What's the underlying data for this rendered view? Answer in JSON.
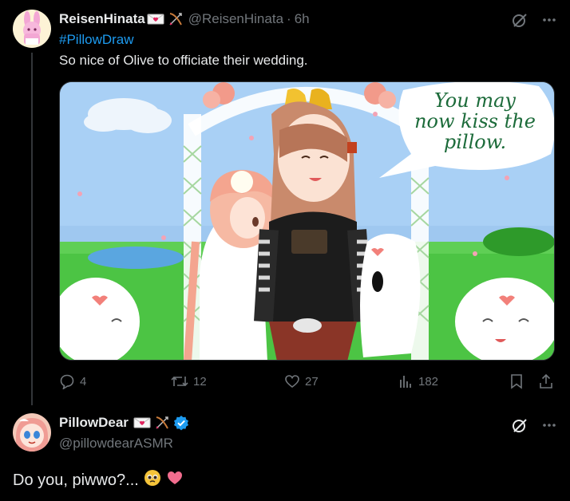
{
  "post": {
    "author_name": "ReisenHinata",
    "author_handle": "@ReisenHinata",
    "separator": "·",
    "time": "6h",
    "hashtag": "#PillowDraw",
    "text": "So nice of Olive to officiate their wedding.",
    "image_speech_text": [
      "You may",
      "now kiss the",
      "pillow."
    ],
    "stats": {
      "replies": "4",
      "reposts": "12",
      "likes": "27",
      "views": "182"
    }
  },
  "reply": {
    "author_name": "PillowDear",
    "author_handle": "@pillowdearASMR",
    "text": "Do you, piwwo?..."
  },
  "colors": {
    "link": "#1d9bf0",
    "muted": "#71767b",
    "text": "#e7e9ea",
    "verified": "#1d9bf0"
  },
  "icons": [
    "grok-icon",
    "more-icon",
    "reply-icon",
    "repost-icon",
    "like-icon",
    "views-icon",
    "bookmark-icon",
    "share-icon",
    "verified-icon",
    "love-letter-icon",
    "bow-arrow-icon",
    "pleading-face-emoji",
    "heart-emoji"
  ]
}
